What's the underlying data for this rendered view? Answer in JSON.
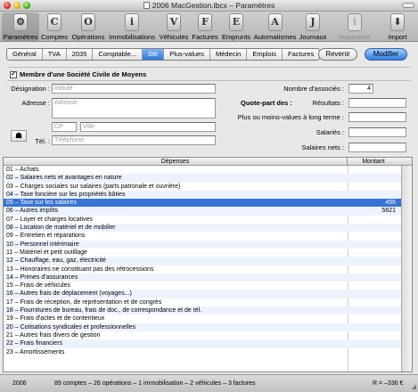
{
  "window": {
    "title": "2006 MacGestion.lbcx – Paramètres"
  },
  "toolbar": {
    "items": [
      {
        "label": "Paramètres",
        "icon": "settings-icon",
        "glyph": "⚙"
      },
      {
        "label": "Comptes",
        "icon": "comptes-icon",
        "glyph": "C"
      },
      {
        "label": "Opérations",
        "icon": "operations-icon",
        "glyph": "O"
      },
      {
        "label": "Immobilisations",
        "icon": "immobilisations-icon",
        "glyph": "i"
      },
      {
        "label": "Véhicules",
        "icon": "vehicules-icon",
        "glyph": "V"
      },
      {
        "label": "Factures",
        "icon": "factures-icon",
        "glyph": "F"
      },
      {
        "label": "Emprunts",
        "icon": "emprunts-icon",
        "glyph": "E"
      },
      {
        "label": "Automatismes",
        "icon": "automatismes-icon",
        "glyph": "A"
      },
      {
        "label": "Journaux",
        "icon": "journaux-icon",
        "glyph": "J"
      },
      {
        "label": "Inspecteur",
        "icon": "inspecteur-icon",
        "glyph": "i"
      },
      {
        "label": "Import",
        "icon": "import-icon",
        "glyph": "⬇"
      }
    ]
  },
  "tabs": [
    "Général",
    "TVA",
    "2035",
    "Comptable...",
    "Sté",
    "Plus-values",
    "Médecin",
    "Emplois",
    "Factures"
  ],
  "buttons": {
    "revenir": "Revenir",
    "modifier": "Modifier"
  },
  "form": {
    "checkbox_label": "Membre d'une Société Civile de Moyens",
    "checkbox_mark": "✓",
    "designation_label": "Désignation :",
    "designation_placeholder": "Intitulé",
    "adresse_label": "Adresse :",
    "adresse_placeholder": "Adresse",
    "cp_placeholder": "CP",
    "ville_placeholder": "Ville",
    "tel_label": "Tél. :",
    "tel_placeholder": "Téléphone",
    "associes_label": "Nombre d'associés :",
    "associes_value": "4",
    "quote_part_label": "Quote-part des :",
    "resultats_label": "Résultats :",
    "plus_moins_label": "Plus ou moins-values à long terme :",
    "salaries_label": "Salariés :",
    "salaries_nets_label": "Salaires nets :"
  },
  "table": {
    "headers": [
      "Dépenses",
      "Montant"
    ],
    "rows": [
      {
        "label": "01 – Achats",
        "amount": ""
      },
      {
        "label": "02 – Salaires nets et avantages en nature",
        "amount": ""
      },
      {
        "label": "03 – Charges sociales sur salaires (parts patronale et ouvrière)",
        "amount": ""
      },
      {
        "label": "04 – Taxe foncière sur les propriétés bâties",
        "amount": ""
      },
      {
        "label": "05 – Taxe sur les salaires",
        "amount": "456",
        "selected": true
      },
      {
        "label": "06 – Autres impôts",
        "amount": "5621"
      },
      {
        "label": "07 – Loyer et charges locatives",
        "amount": ""
      },
      {
        "label": "08 – Location de matériel et de mobilier",
        "amount": ""
      },
      {
        "label": "09 – Entretien et réparations",
        "amount": ""
      },
      {
        "label": "10 – Personnel intérimaire",
        "amount": ""
      },
      {
        "label": "11 – Matériel et petit outillage",
        "amount": ""
      },
      {
        "label": "12 – Chauffage, eau, gaz, électricité",
        "amount": ""
      },
      {
        "label": "13 – Honoraires ne constituant pas des rétrocessions",
        "amount": ""
      },
      {
        "label": "14 – Primes d'assurances",
        "amount": ""
      },
      {
        "label": "15 – Frais de véhicules",
        "amount": ""
      },
      {
        "label": "16 – Autres frais de déplacement (voyages...)",
        "amount": ""
      },
      {
        "label": "17 – Frais de réception, de représentation et de congrès",
        "amount": ""
      },
      {
        "label": "18 – Fournitures de bureau, frais de doc., de correspondance et de tél.",
        "amount": ""
      },
      {
        "label": "19 – Frais d'actes et de contentieux",
        "amount": ""
      },
      {
        "label": "20 – Cotisations syndicales et professionnelles",
        "amount": ""
      },
      {
        "label": "21 – Autres frais divers de gestion",
        "amount": ""
      },
      {
        "label": "22 – Frais financiers",
        "amount": ""
      },
      {
        "label": "23 – Amortissements",
        "amount": ""
      }
    ]
  },
  "status": {
    "year": "2006",
    "summary": "89 comptes – 26 opérations – 1 immobilisation – 2 véhicules – 3 factures",
    "result": "R = –336 €"
  },
  "colors": {
    "selection": "#3874d6",
    "accent": "#2f7be0"
  }
}
